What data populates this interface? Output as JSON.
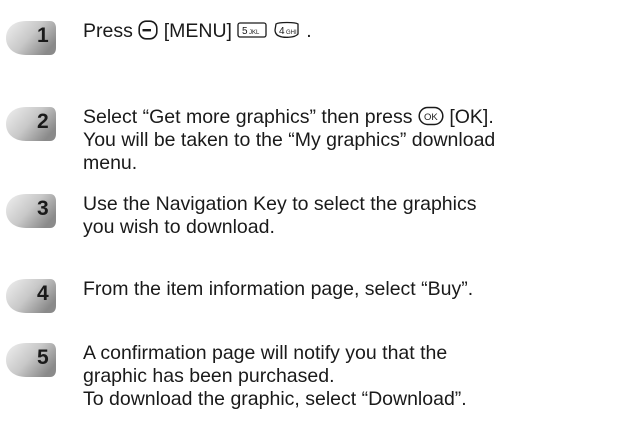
{
  "steps": [
    {
      "number": "1",
      "parts": {
        "press": "Press",
        "menu": "[MENU]",
        "key5_digit": "5",
        "key5_letters": "JKL",
        "key4_digit": "4",
        "key4_letters": "GHI",
        "period": "."
      }
    },
    {
      "number": "2",
      "line1a": "Select “Get more graphics” then press",
      "ok_icon": "OK",
      "line1b": "[OK].",
      "line2": "You will be taken to the “My graphics” download",
      "line3": "menu."
    },
    {
      "number": "3",
      "line1": "Use the Navigation Key to select the graphics",
      "line2": "you wish to download."
    },
    {
      "number": "4",
      "line1": "From the item information page, select “Buy”."
    },
    {
      "number": "5",
      "line1": "A confirmation page will notify you that the",
      "line2": "graphic has been purchased.",
      "line3": "To download the graphic, select “Download”."
    }
  ],
  "colors": {
    "badge_light": "#e2e2e2",
    "badge_dark": "#8f8f8f",
    "text": "#1a1a1a"
  },
  "icons": {
    "left_softkey": "left-softkey-icon",
    "key5": "key-5-jkl-icon",
    "key4": "key-4-ghi-icon",
    "ok_key": "ok-key-icon"
  }
}
